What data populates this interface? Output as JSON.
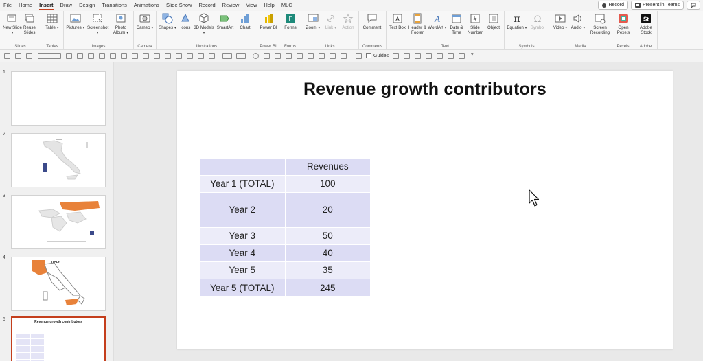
{
  "menu": {
    "tabs": [
      "File",
      "Home",
      "Insert",
      "Draw",
      "Design",
      "Transitions",
      "Animations",
      "Slide Show",
      "Record",
      "Review",
      "View",
      "Help",
      "MLC"
    ],
    "active": "Insert",
    "record_label": "Record",
    "present_label": "Present in Teams"
  },
  "ribbon": {
    "groups": {
      "slides": "Slides",
      "tables": "Tables",
      "images": "Images",
      "camera": "Camera",
      "illustrations": "Illustrations",
      "powerbi": "Power BI",
      "forms": "Forms",
      "links": "Links",
      "comments": "Comments",
      "text": "Text",
      "symbols": "Symbols",
      "media": "Media",
      "pexels": "Pexels",
      "adobe": "Adobe"
    },
    "buttons": {
      "new_slide": "New Slide ▾",
      "reuse_slides": "Reuse Slides",
      "table": "Table ▾",
      "pictures": "Pictures ▾",
      "screenshot": "Screenshot ▾",
      "photo_album": "Photo Album ▾",
      "cameo": "Cameo ▾",
      "shapes": "Shapes ▾",
      "icons": "Icons",
      "models_3d": "3D Models ▾",
      "smartart": "SmartArt",
      "chart": "Chart",
      "power_bi": "Power BI",
      "forms": "Forms",
      "zoom": "Zoom ▾",
      "link": "Link ▾",
      "action": "Action",
      "comment": "Comment",
      "text_box": "Text Box",
      "header_footer": "Header & Footer",
      "wordart": "WordArt ▾",
      "date_time": "Date & Time",
      "slide_number": "Slide Number",
      "object": "Object",
      "equation": "Equation ▾",
      "symbol": "Symbol",
      "video": "Video ▾",
      "audio": "Audio ▾",
      "screen_recording": "Screen Recording",
      "open_pexels": "Open Pexels",
      "adobe_stock": "Adobe Stock"
    }
  },
  "qat": {
    "guides_label": "Guides"
  },
  "thumbnails": {
    "numbers": [
      "1",
      "2",
      "3",
      "4",
      "5"
    ],
    "slide4_title": "ITALY",
    "slide5_title": "Revenue growth contributors"
  },
  "slide": {
    "title": "Revenue growth contributors",
    "table": {
      "header": [
        "",
        "Revenues"
      ],
      "rows": [
        [
          "Year 1 (TOTAL)",
          "100"
        ],
        [
          "Year 2",
          "20"
        ],
        [
          "Year 3",
          "50"
        ],
        [
          "Year 4",
          "40"
        ],
        [
          "Year 5",
          "35"
        ],
        [
          "Year 5 (TOTAL)",
          "245"
        ]
      ]
    }
  },
  "colors": {
    "accent": "#c43e1c",
    "table_dark": "#dcdcf4",
    "table_light": "#ececf9",
    "map_orange": "#e8823a",
    "map_navy": "#3b4a8a"
  }
}
